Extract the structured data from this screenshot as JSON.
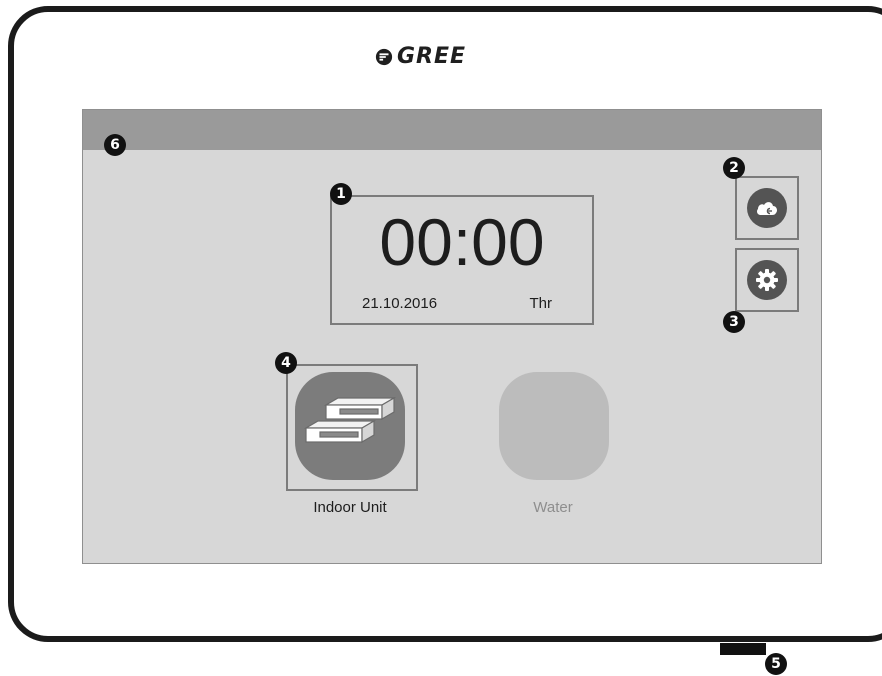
{
  "brand": {
    "name": "GREE"
  },
  "clock": {
    "time": "00:00",
    "date": "21.10.2016",
    "day": "Thr"
  },
  "apps": [
    {
      "label": "Indoor Unit",
      "icon": "indoor-unit-icon",
      "state": "active"
    },
    {
      "label": "Water",
      "icon": "",
      "state": "disabled"
    }
  ],
  "buttons": {
    "cloud_icon": "cloud-icon",
    "settings_icon": "gear-icon"
  },
  "callouts": [
    "1",
    "2",
    "3",
    "4",
    "5",
    "6"
  ],
  "colors": {
    "screen_background": "#d7d7d7",
    "top_bar": "#9a9a9a",
    "active_tile": "#7c7c7c",
    "disabled_tile": "#bcbcbc",
    "round_button": "#545454"
  }
}
